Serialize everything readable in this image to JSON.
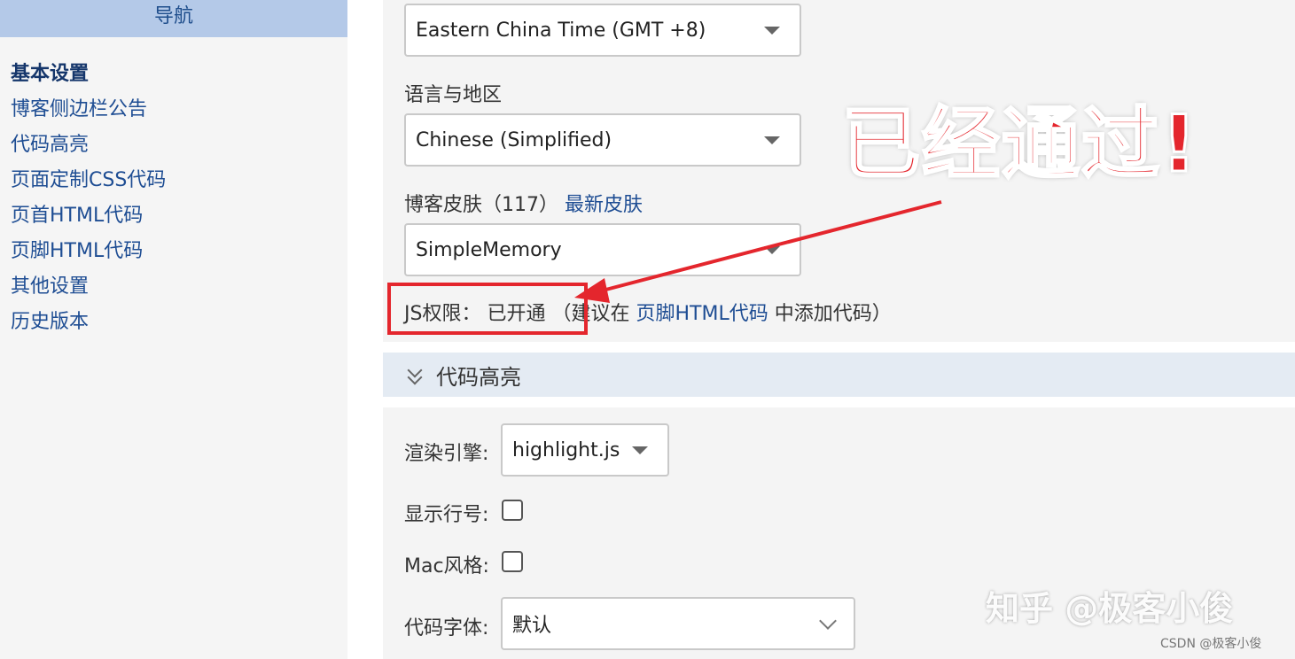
{
  "sidebar": {
    "title": "导航",
    "items": [
      {
        "label": "基本设置",
        "active": true
      },
      {
        "label": "博客侧边栏公告"
      },
      {
        "label": "代码高亮"
      },
      {
        "label": "页面定制CSS代码"
      },
      {
        "label": "页首HTML代码"
      },
      {
        "label": "页脚HTML代码"
      },
      {
        "label": "其他设置"
      },
      {
        "label": "历史版本"
      }
    ]
  },
  "basic": {
    "timezone_value": "Eastern China Time (GMT +8)",
    "language_label": "语言与地区",
    "language_value": "Chinese (Simplified)",
    "skin_label": "博客皮肤（117）",
    "skin_link": "最新皮肤",
    "skin_value": "SimpleMemory",
    "js_label": "JS权限：",
    "js_status": "已开通",
    "js_hint_prefix": "（建议在",
    "js_hint_link": "页脚HTML代码",
    "js_hint_suffix": "中添加代码）"
  },
  "highlight": {
    "section_title": "代码高亮",
    "engine_label": "渲染引擎:",
    "engine_value": "highlight.js",
    "line_number_label": "显示行号:",
    "mac_style_label": "Mac风格:",
    "font_label": "代码字体:",
    "font_value": "默认"
  },
  "annotation": {
    "callout_text": "已经通过!",
    "color": "#e4262d"
  },
  "watermark": {
    "text": "知乎 @极客小俊",
    "credit": "CSDN @极客小俊"
  },
  "colors": {
    "accent": "#1e4d93",
    "sidebar_header": "#b4c9e8",
    "section_header": "#e4ebf3"
  }
}
